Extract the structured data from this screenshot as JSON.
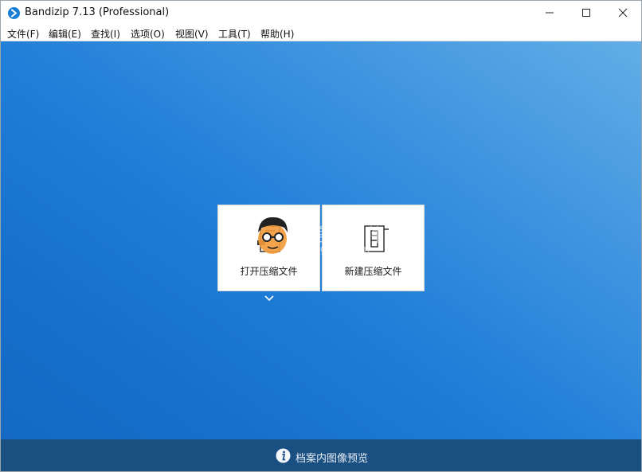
{
  "window": {
    "title": "Bandizip 7.13 (Professional)"
  },
  "icons": {
    "app": "bandizip-app-icon",
    "minimize": "minimize-icon",
    "maximize": "maximize-icon",
    "close": "close-icon",
    "open_archive": "open-archive-icon",
    "new_archive": "new-archive-icon",
    "expand": "chevron-down-icon",
    "info": "info-icon"
  },
  "menu": [
    {
      "label": "文件(F)"
    },
    {
      "label": "编辑(E)"
    },
    {
      "label": "查找(I)"
    },
    {
      "label": "选项(O)"
    },
    {
      "label": "视图(V)"
    },
    {
      "label": "工具(T)"
    },
    {
      "label": "帮助(H)"
    }
  ],
  "actions": {
    "open_label": "打开压缩文件",
    "new_label": "新建压缩文件"
  },
  "watermark": {
    "line1": "锅盖头软件",
    "line2": "www.ggtrj.com"
  },
  "status": {
    "text": "档案内图像预览"
  },
  "colors": {
    "accent": "#1a7fd4",
    "content_gradient_light": "#62aee6",
    "content_gradient_dark": "#1569c3",
    "statusbar": "#1a4f82"
  }
}
